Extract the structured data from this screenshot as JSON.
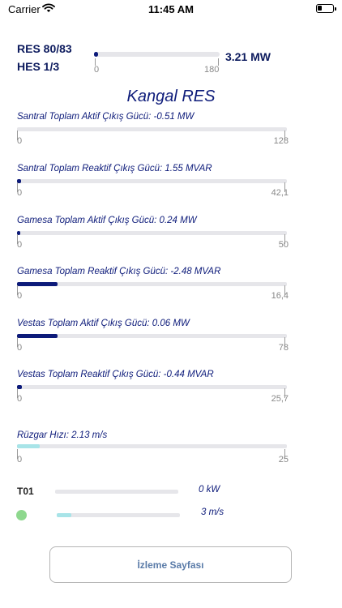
{
  "status_bar": {
    "carrier": "Carrier",
    "time": "11:45 AM"
  },
  "summary": {
    "res_label": "RES 80/83",
    "hes_label": "HES 1/3",
    "bar_min": "0",
    "bar_max": "180",
    "bar_fraction": 0.03,
    "total_power": "3.21 MW"
  },
  "title": "Kangal RES",
  "colors": {
    "dark_fill": "#0d1b7a",
    "light_fill": "#a8e4e8",
    "status_dot": "#8ed88e"
  },
  "metrics": [
    {
      "label": "Santral Toplam Aktif Çıkış Gücü: -0.51 MW",
      "min": "0",
      "max": "128",
      "fraction": 0.0
    },
    {
      "label": "Santral Toplam Reaktif Çıkış Gücü: 1.55 MVAR",
      "min": "0",
      "max": "42,1",
      "fraction": 0.015
    },
    {
      "label": "Gamesa Toplam Aktif Çıkış Gücü: 0.24 MW",
      "min": "0",
      "max": "50",
      "fraction": 0.012
    },
    {
      "label": "Gamesa Toplam Reaktif Çıkış Gücü: -2.48 MVAR",
      "min": "0",
      "max": "16,4",
      "fraction": 0.15
    },
    {
      "label": "Vestas Toplam Aktif Çıkış Gücü: 0.06 MW",
      "min": "0",
      "max": "78",
      "fraction": 0.15
    },
    {
      "label": "Vestas Toplam Reaktif Çıkış Gücü: -0.44 MVAR",
      "min": "0",
      "max": "25,7",
      "fraction": 0.017
    },
    {
      "label": "Rüzgar Hızı: 2.13 m/s",
      "min": "0",
      "max": "25",
      "fraction": 0.085
    }
  ],
  "turbine": {
    "id": "T01",
    "power_value": "0 kW",
    "power_fraction": 0.0,
    "wind_value": "3 m/s",
    "wind_fraction": 0.12
  },
  "button": {
    "label": "İzleme Sayfası"
  }
}
